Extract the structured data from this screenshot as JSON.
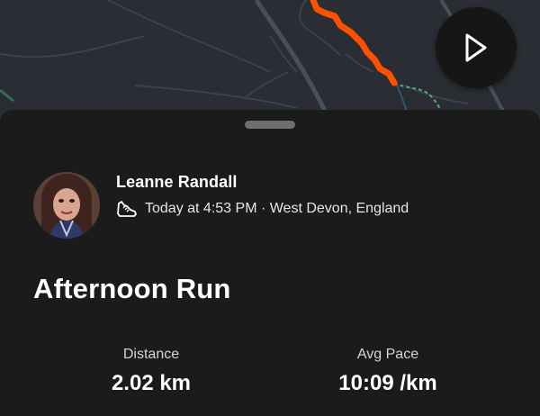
{
  "map": {
    "route_color": "#fc5200",
    "background_color": "#2a2d33",
    "road_color": "#4a4f57"
  },
  "controls": {
    "play_icon": "play-icon"
  },
  "activity": {
    "athlete_name": "Leanne Randall",
    "sport_icon": "running-shoe-icon",
    "date_location": "Today at 4:53 PM · West Devon, England",
    "title": "Afternoon Run"
  },
  "stats": [
    {
      "label": "Distance",
      "value": "2.02 km"
    },
    {
      "label": "Avg Pace",
      "value": "10:09 /km"
    }
  ]
}
